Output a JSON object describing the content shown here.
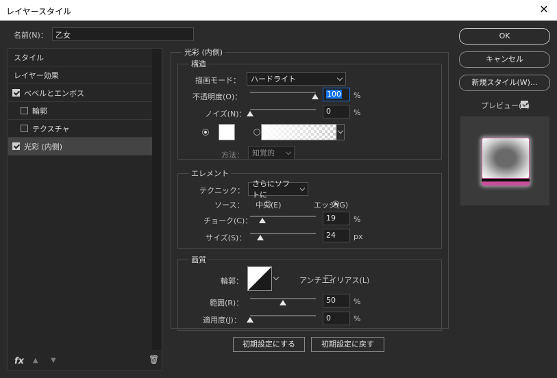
{
  "window": {
    "title": "レイヤースタイル",
    "close_glyph": "✕"
  },
  "name_field": {
    "label": "名前(N)：",
    "value": "乙女"
  },
  "left_list": [
    {
      "label": "スタイル",
      "checkbox": null,
      "selected": false
    },
    {
      "label": "レイヤー効果",
      "checkbox": null,
      "selected": false
    },
    {
      "label": "ベベルとエンボス",
      "checkbox": true,
      "selected": false
    },
    {
      "label": "輪郭",
      "checkbox": false,
      "selected": false
    },
    {
      "label": "テクスチャ",
      "checkbox": false,
      "selected": false
    },
    {
      "label": "光彩 (内側)",
      "checkbox": true,
      "selected": true
    }
  ],
  "bottom_icons": {
    "fx": "fx",
    "up": "▲",
    "down": "▼",
    "trash": "🗑"
  },
  "panel": {
    "title": "光彩 (内側)",
    "structure": {
      "title": "構造",
      "blend_mode_label": "描画モード：",
      "blend_mode_value": "ハードライト",
      "opacity_label": "不透明度(O)：",
      "opacity_value": "100",
      "opacity_unit": "%",
      "noise_label": "ノイズ(N)：",
      "noise_value": "0",
      "noise_unit": "%",
      "method_label": "方法：",
      "method_value": "知覚的"
    },
    "elements": {
      "title": "エレメント",
      "technique_label": "テクニック：",
      "technique_value": "さらにソフトに",
      "source_label": "ソース：",
      "source_center": "中央(E)",
      "source_edge": "エッジ(G)",
      "choke_label": "チョーク(C)：",
      "choke_value": "19",
      "choke_unit": "%",
      "size_label": "サイズ(S)：",
      "size_value": "24",
      "size_unit": "px"
    },
    "quality": {
      "title": "画質",
      "contour_label": "輪郭：",
      "antialias_label": "アンチエイリアス(L)",
      "range_label": "範囲(R)：",
      "range_value": "50",
      "range_unit": "%",
      "jitter_label": "適用度(J)：",
      "jitter_value": "0",
      "jitter_unit": "%"
    },
    "buttons": {
      "make_default": "初期設定にする",
      "reset_default": "初期設定に戻す"
    }
  },
  "right": {
    "ok": "OK",
    "cancel": "キャンセル",
    "new_style": "新規スタイル(W)...",
    "preview_label": "プレビュー(V)"
  },
  "colors": {
    "glow_pink": "#e040a0",
    "accent_blue": "#1473e6"
  }
}
